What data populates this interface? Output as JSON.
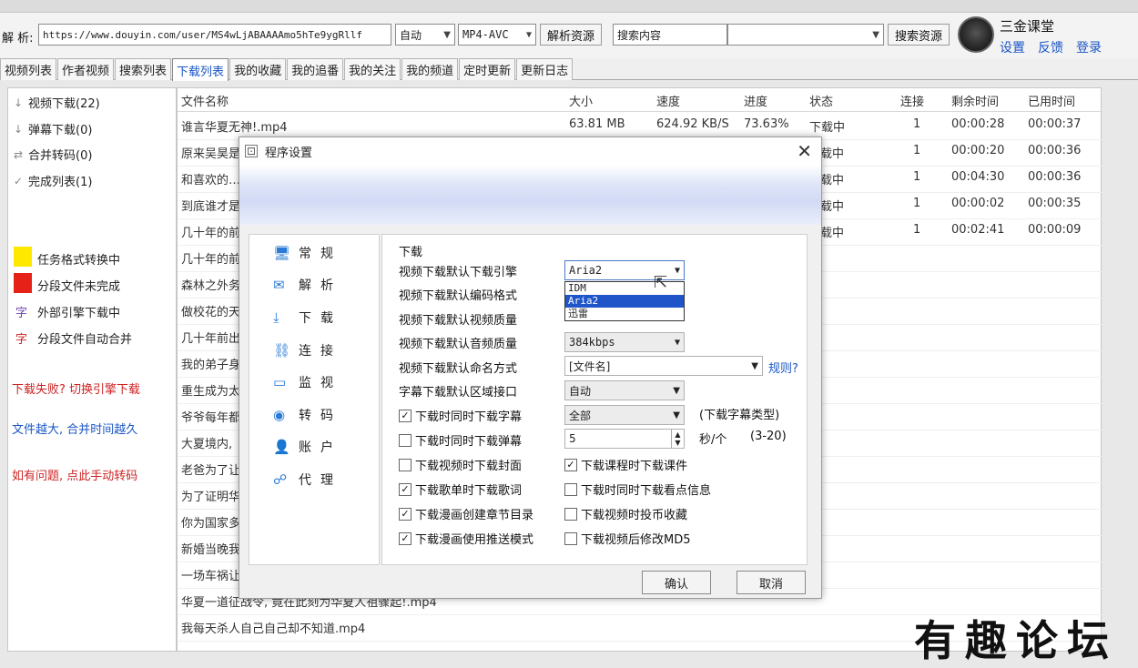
{
  "toolbar": {
    "parse_label": "解 析:",
    "url_value": "https://www.douyin.com/user/MS4wLjABAAAAmo5hTe9ygRllf",
    "mode_value": "自动",
    "format_value": "MP4-AVC",
    "parse_button": "解析资源",
    "search_value": "搜索内容",
    "search_button": "搜索资源",
    "user_name": "三金课堂",
    "settings_link": "设置",
    "feedback_link": "反馈",
    "login_link": "登录"
  },
  "tabs": [
    "视频列表",
    "作者视频",
    "搜索列表",
    "下载列表",
    "我的收藏",
    "我的追番",
    "我的关注",
    "我的频道",
    "定时更新",
    "更新日志"
  ],
  "active_tab": 3,
  "left_panel": {
    "items": [
      {
        "icon": "↓",
        "label": "视频下载(22)"
      },
      {
        "icon": "↓",
        "label": "弹幕下载(0)"
      },
      {
        "icon": "⇄",
        "label": "合并转码(0)"
      },
      {
        "icon": "✓",
        "label": "完成列表(1)"
      }
    ],
    "legend": [
      {
        "color": "#ffe800",
        "label": "任务格式转换中"
      },
      {
        "color": "#e62118",
        "label": "分段文件未完成"
      },
      {
        "glyph": "字",
        "label": "外部引擎下载中"
      },
      {
        "glyph": "字",
        "label": "分段文件自动合并"
      }
    ],
    "tips": [
      "下载失败? 切换引擎下载",
      "文件越大, 合并时间越久",
      "如有问题, 点此手动转码"
    ]
  },
  "table": {
    "headers": [
      "文件名称",
      "大小",
      "速度",
      "进度",
      "状态",
      "连接",
      "剩余时间",
      "已用时间"
    ],
    "rows": [
      [
        "谁言华夏无神!.mp4",
        "63.81 MB",
        "624.92 KB/S",
        "73.63%",
        "下载中",
        "1",
        "00:00:28",
        "00:00:37"
      ],
      [
        "原来吴昊是",
        "",
        "",
        "",
        "载中",
        "1",
        "00:00:20",
        "00:00:36"
      ],
      [
        "和喜欢的…",
        "",
        "",
        "",
        "载中",
        "1",
        "00:04:30",
        "00:00:36"
      ],
      [
        "到底谁才是",
        "",
        "",
        "",
        "载中",
        "1",
        "00:00:02",
        "00:00:35"
      ],
      [
        "几十年的前",
        "",
        "",
        "",
        "载中",
        "1",
        "00:02:41",
        "00:00:09"
      ],
      [
        "几十年的前"
      ],
      [
        "森林之外务"
      ],
      [
        "做校花的天"
      ],
      [
        "几十年前出"
      ],
      [
        "我的弟子身"
      ],
      [
        "重生成为太"
      ],
      [
        "爷爷每年都"
      ],
      [
        "大夏境内,"
      ],
      [
        "老爸为了让"
      ],
      [
        "为了证明华"
      ],
      [
        "你为国家多"
      ],
      [
        "新婚当晚我"
      ],
      [
        "一场车祸让"
      ],
      [
        "华夏一道征战令, 竟在此刻为华夏人祖骤起!.mp4"
      ],
      [
        "我每天杀人自己自己却不知道.mp4"
      ]
    ]
  },
  "dialog": {
    "title": "程序设置",
    "nav": [
      {
        "icon": "🖥",
        "label": "常规"
      },
      {
        "icon": "✉",
        "label": "解析"
      },
      {
        "icon": "⤓",
        "label": "下载"
      },
      {
        "icon": "⛓",
        "label": "连接"
      },
      {
        "icon": "▭",
        "label": "监视"
      },
      {
        "icon": "◉",
        "label": "转码"
      },
      {
        "icon": "👤",
        "label": "账户"
      },
      {
        "icon": "☍",
        "label": "代理"
      }
    ],
    "section": "下载",
    "engine_label": "视频下载默认下载引擎",
    "engine_value": "Aria2",
    "engine_options": [
      "IDM",
      "Aria2",
      "迅雷"
    ],
    "engine_selected": 1,
    "codec_label": "视频下载默认编码格式",
    "quality_label": "视频下载默认视频质量",
    "audio_label": "视频下载默认音频质量",
    "audio_value": "384kbps",
    "naming_label": "视频下载默认命名方式",
    "naming_value": "[文件名]",
    "rules_link": "规则?",
    "subtitle_label": "字幕下载默认区域接口",
    "subtitle_value": "自动",
    "cb_subtitle": "下载时同时下载字幕",
    "subtitle_type_value": "全部",
    "subtitle_type_note": "(下载字幕类型)",
    "cb_danmaku": "下载时同时下载弹幕",
    "danmaku_interval": "5",
    "interval_note": "秒/个",
    "interval_range": "(3-20)",
    "cb_cover": "下载视频时下载封面",
    "cb_courseware": "下载课程时下载课件",
    "cb_lyrics": "下载歌单时下载歌词",
    "cb_points": "下载时同时下载看点信息",
    "cb_comic_toc": "下载漫画创建章节目录",
    "cb_coin": "下载视频时投币收藏",
    "cb_comic_push": "下载漫画使用推送模式",
    "cb_md5": "下载视频后修改MD5",
    "ok_button": "确认",
    "cancel_button": "取消",
    "checked": {
      "subtitle": true,
      "danmaku": false,
      "cover": false,
      "courseware": true,
      "lyrics": true,
      "points": false,
      "comic_toc": true,
      "coin": false,
      "comic_push": true,
      "md5": false
    }
  },
  "watermark": "有趣论坛"
}
